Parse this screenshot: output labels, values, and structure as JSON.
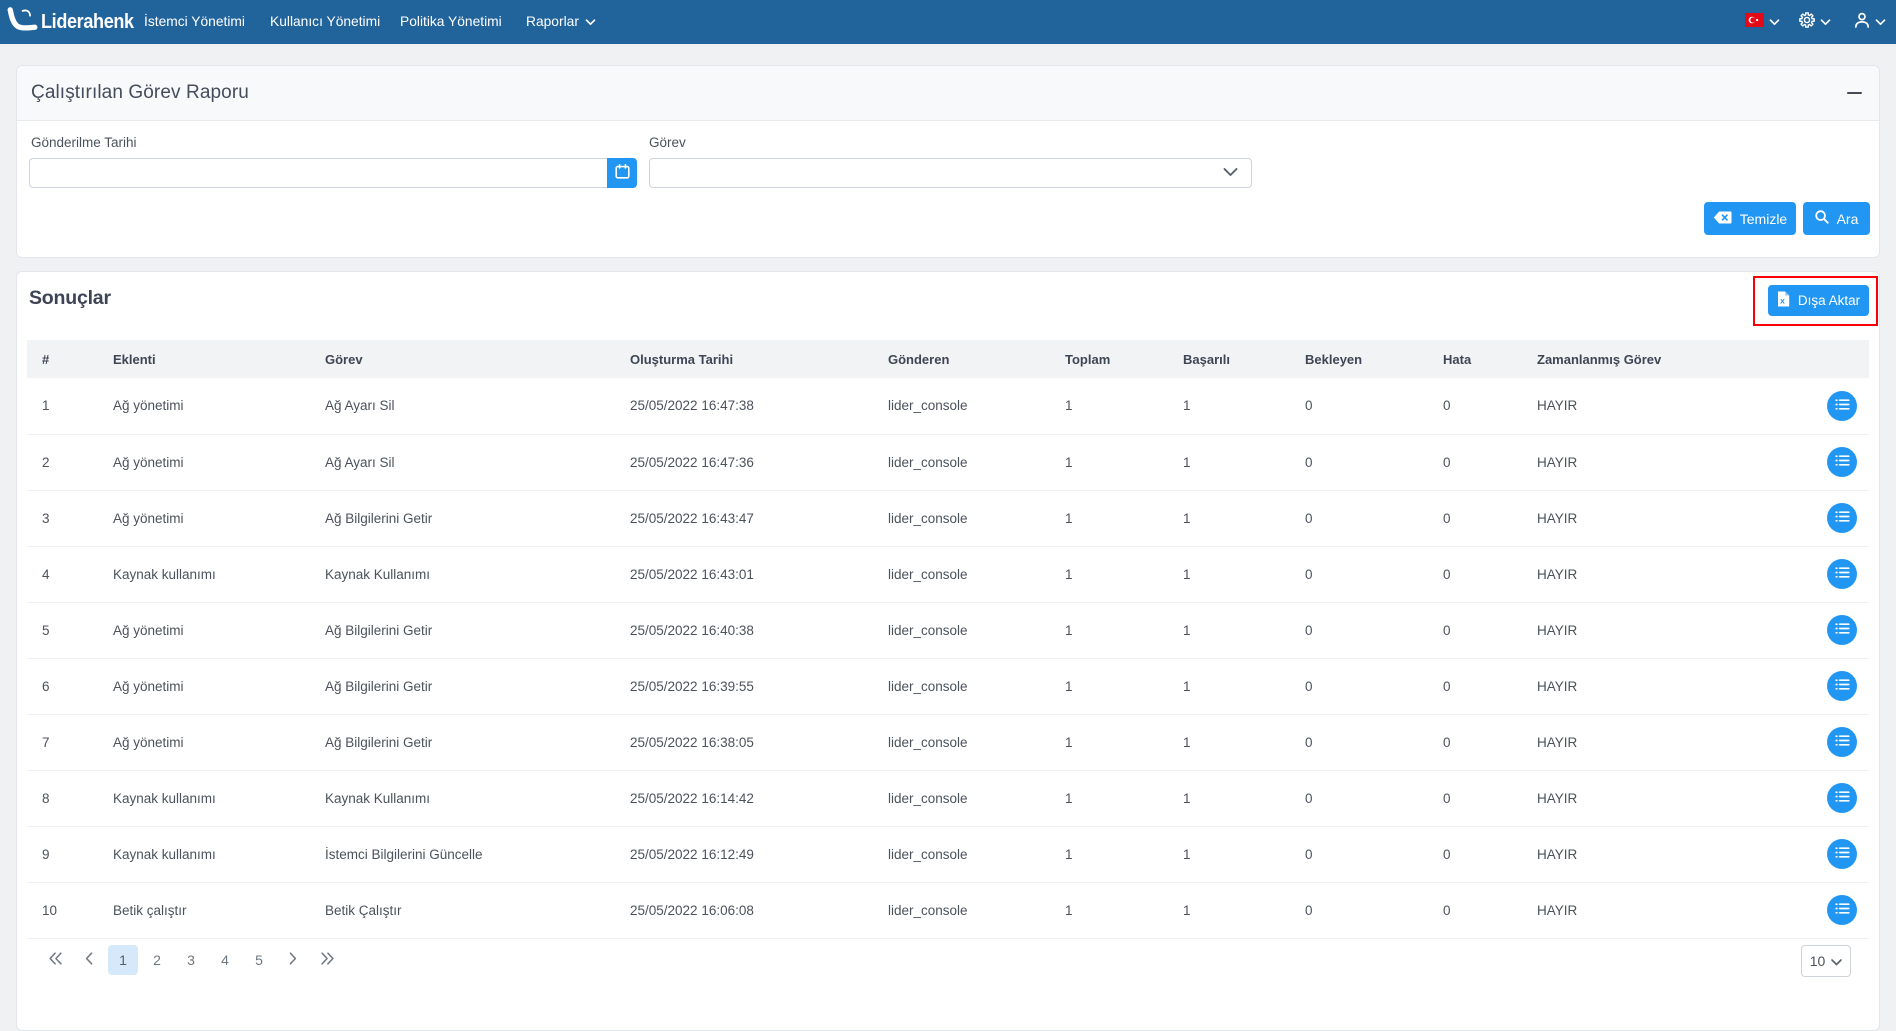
{
  "navbar": {
    "brand": "Liderahenk",
    "items": [
      {
        "label": "İstemci Yönetimi",
        "caret": false
      },
      {
        "label": "Kullanıcı Yönetimi",
        "caret": false
      },
      {
        "label": "Politika Yönetimi",
        "caret": false
      },
      {
        "label": "Raporlar",
        "caret": true
      }
    ],
    "right_icons": [
      "turkish-flag",
      "gear",
      "user"
    ]
  },
  "filter": {
    "title": "Çalıştırılan Görev Raporu",
    "fields": [
      {
        "label": "Gönderilme Tarihi",
        "value": "",
        "type": "date-input"
      },
      {
        "label": "Görev",
        "value": "",
        "type": "select"
      }
    ],
    "clear_label": "Temizle",
    "search_label": "Ara"
  },
  "results": {
    "title": "Sonuçlar",
    "export_label": "Dışa Aktar",
    "table": {
      "headers": [
        "#",
        "Eklenti",
        "Görev",
        "Oluşturma Tarihi",
        "Gönderen",
        "Toplam",
        "Başarılı",
        "Bekleyen",
        "Hata",
        "Zamanlanmış Görev",
        ""
      ],
      "rows": [
        [
          "1",
          "Ağ yönetimi",
          "Ağ Ayarı Sil",
          "25/05/2022 16:47:38",
          "lider_console",
          "1",
          "1",
          "0",
          "0",
          "HAYIR"
        ],
        [
          "2",
          "Ağ yönetimi",
          "Ağ Ayarı Sil",
          "25/05/2022 16:47:36",
          "lider_console",
          "1",
          "1",
          "0",
          "0",
          "HAYIR"
        ],
        [
          "3",
          "Ağ yönetimi",
          "Ağ Bilgilerini Getir",
          "25/05/2022 16:43:47",
          "lider_console",
          "1",
          "1",
          "0",
          "0",
          "HAYIR"
        ],
        [
          "4",
          "Kaynak kullanımı",
          "Kaynak Kullanımı",
          "25/05/2022 16:43:01",
          "lider_console",
          "1",
          "1",
          "0",
          "0",
          "HAYIR"
        ],
        [
          "5",
          "Ağ yönetimi",
          "Ağ Bilgilerini Getir",
          "25/05/2022 16:40:38",
          "lider_console",
          "1",
          "1",
          "0",
          "0",
          "HAYIR"
        ],
        [
          "6",
          "Ağ yönetimi",
          "Ağ Bilgilerini Getir",
          "25/05/2022 16:39:55",
          "lider_console",
          "1",
          "1",
          "0",
          "0",
          "HAYIR"
        ],
        [
          "7",
          "Ağ yönetimi",
          "Ağ Bilgilerini Getir",
          "25/05/2022 16:38:05",
          "lider_console",
          "1",
          "1",
          "0",
          "0",
          "HAYIR"
        ],
        [
          "8",
          "Kaynak kullanımı",
          "Kaynak Kullanımı",
          "25/05/2022 16:14:42",
          "lider_console",
          "1",
          "1",
          "0",
          "0",
          "HAYIR"
        ],
        [
          "9",
          "Kaynak kullanımı",
          "İstemci Bilgilerini Güncelle",
          "25/05/2022 16:12:49",
          "lider_console",
          "1",
          "1",
          "0",
          "0",
          "HAYIR"
        ],
        [
          "10",
          "Betik çalıştır",
          "Betik Çalıştır",
          "25/05/2022 16:06:08",
          "lider_console",
          "1",
          "1",
          "0",
          "0",
          "HAYIR"
        ]
      ]
    },
    "pagination": {
      "first": "«",
      "prev": "‹",
      "pages": [
        "1",
        "2",
        "3",
        "4",
        "5"
      ],
      "active_page": "1",
      "next": "›",
      "last": "»",
      "page_size": "10"
    }
  },
  "colors": {
    "navbar": "#21639b",
    "primary": "#2196f3",
    "annotation_red": "#fb0007",
    "active_page_bg": "#d6e9fb"
  }
}
